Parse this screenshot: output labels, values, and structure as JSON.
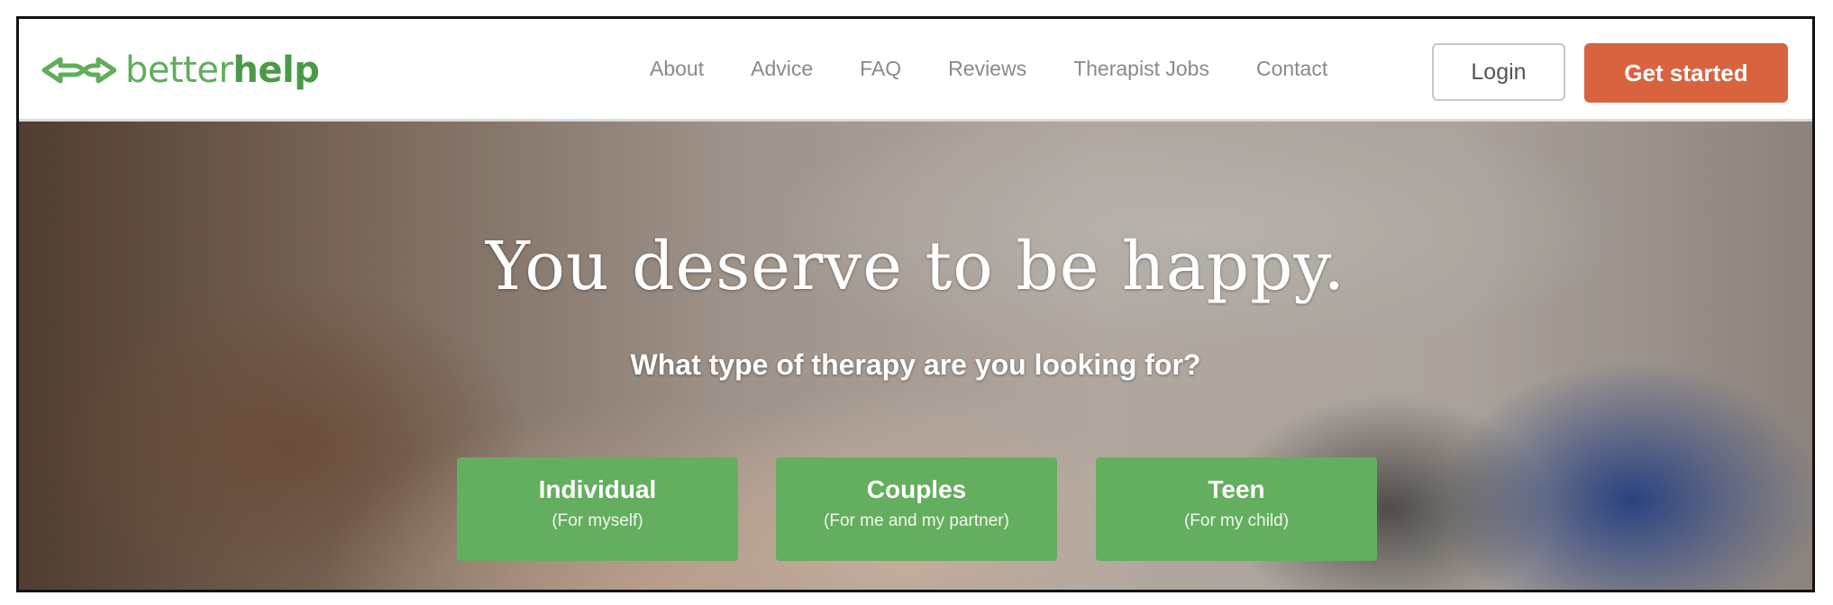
{
  "brand": {
    "name_light": "better",
    "name_bold": "help",
    "logo_icon": "betterhelp-logo-icon",
    "color": "#5fae5c"
  },
  "nav": {
    "links": [
      {
        "label": "About"
      },
      {
        "label": "Advice"
      },
      {
        "label": "FAQ"
      },
      {
        "label": "Reviews"
      },
      {
        "label": "Therapist Jobs"
      },
      {
        "label": "Contact"
      }
    ],
    "login_label": "Login",
    "cta_label": "Get started",
    "cta_color": "#d9623f"
  },
  "hero": {
    "title": "You deserve to be happy.",
    "subtitle": "What type of therapy are you looking for?",
    "choices": [
      {
        "title": "Individual",
        "subtitle": "(For myself)"
      },
      {
        "title": "Couples",
        "subtitle": "(For me and my partner)"
      },
      {
        "title": "Teen",
        "subtitle": "(For my child)"
      }
    ],
    "choice_color": "#64ae5f"
  }
}
